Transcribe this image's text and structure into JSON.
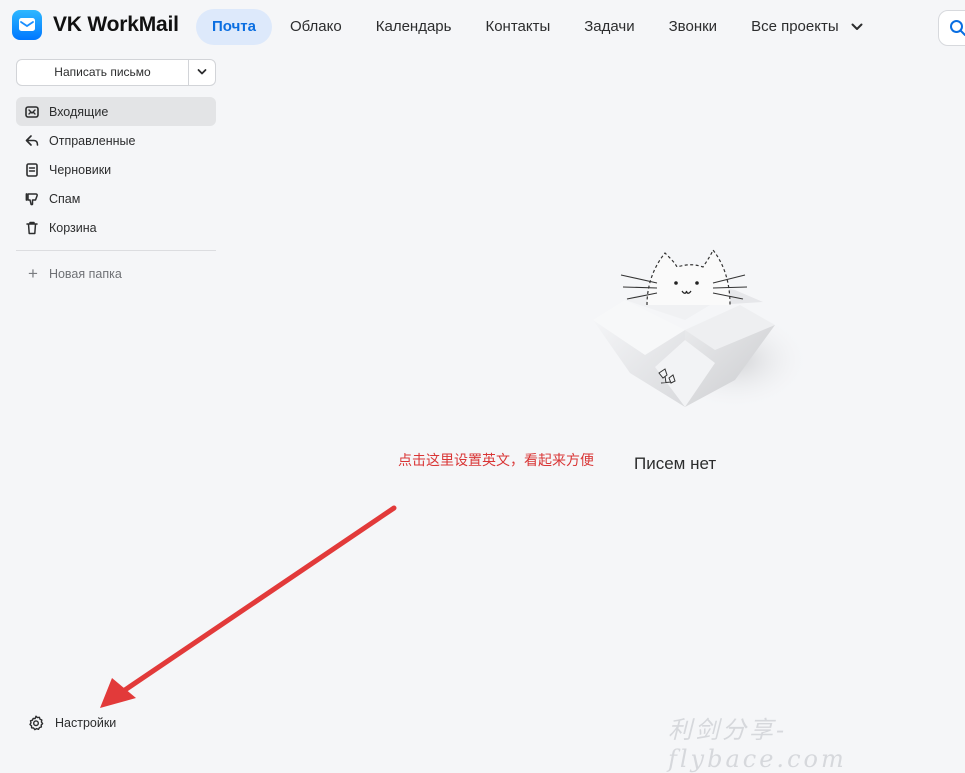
{
  "app": {
    "name": "VK WorkMail"
  },
  "nav": {
    "items": [
      {
        "label": "Почта",
        "active": true
      },
      {
        "label": "Облако"
      },
      {
        "label": "Календарь"
      },
      {
        "label": "Контакты"
      },
      {
        "label": "Задачи"
      },
      {
        "label": "Звонки"
      },
      {
        "label": "Все проекты"
      }
    ]
  },
  "sidebar": {
    "compose_label": "Написать письмо",
    "folders": [
      {
        "label": "Входящие",
        "icon": "inbox-icon",
        "active": true
      },
      {
        "label": "Отправленные",
        "icon": "sent-icon"
      },
      {
        "label": "Черновики",
        "icon": "drafts-icon"
      },
      {
        "label": "Спам",
        "icon": "spam-icon"
      },
      {
        "label": "Корзина",
        "icon": "trash-icon"
      }
    ],
    "new_folder_label": "Новая папка",
    "settings_label": "Настройки"
  },
  "main": {
    "empty_text": "Писем нет"
  },
  "annotation": {
    "text": "点击这里设置英文，看起来方便"
  },
  "watermark": {
    "text": "利剑分享-flybace.com"
  },
  "colors": {
    "accent": "#0a6ee1",
    "nav_active_bg": "#dde9fb",
    "annotation": "#d93636",
    "background": "#f5f6f8"
  }
}
